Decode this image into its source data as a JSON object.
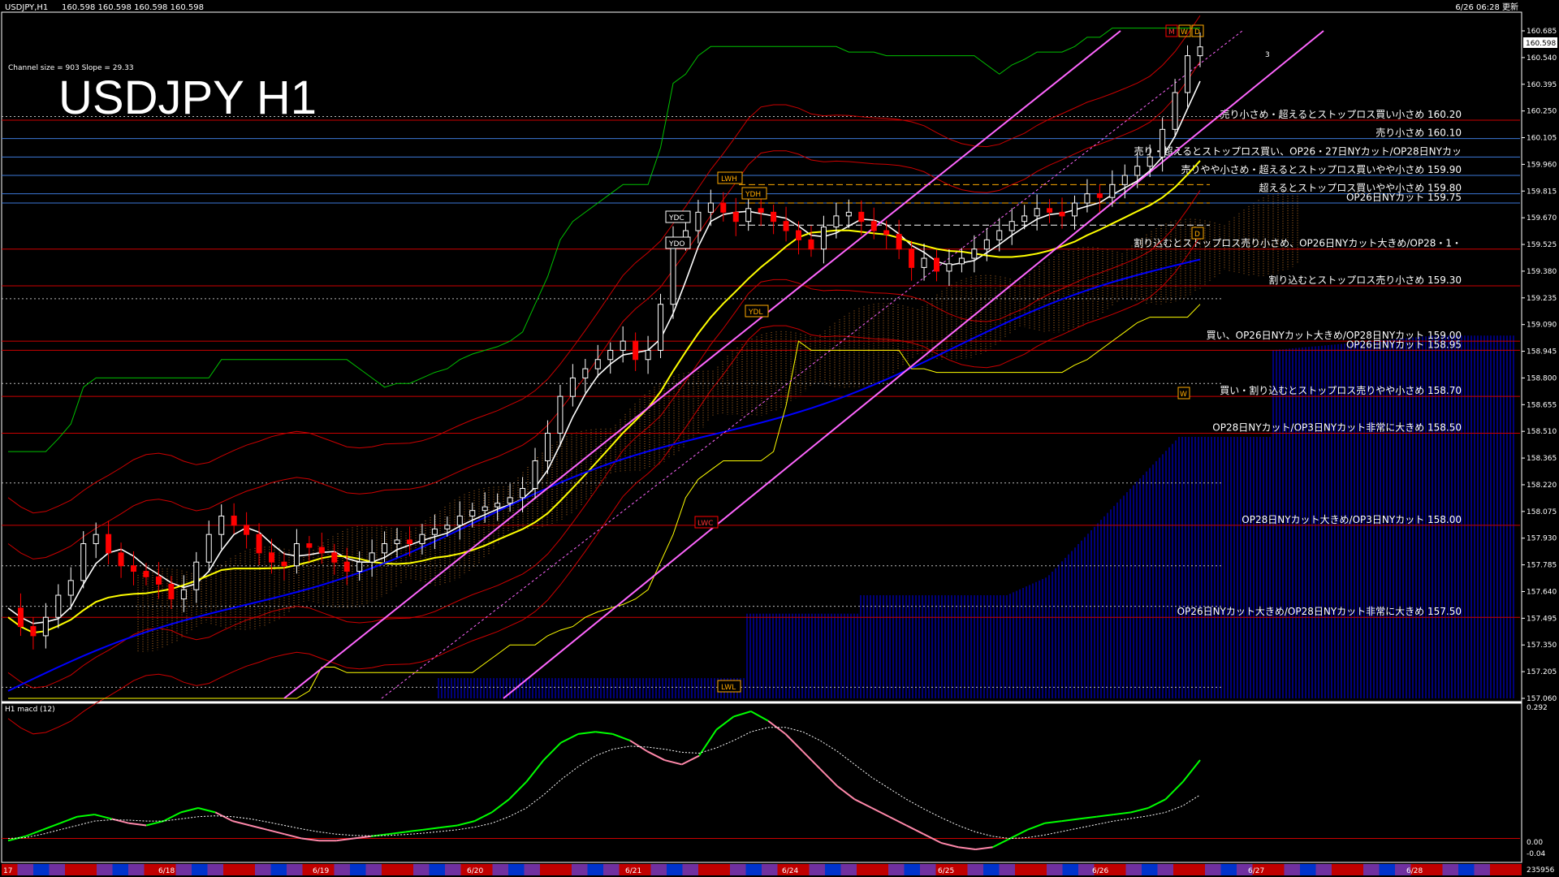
{
  "header": {
    "symbol_info": "USDJPY,H1",
    "ohlc": "160.598 160.598 160.598 160.598",
    "updated": "6/26 06:28 更新",
    "channel_info": "Channel size = 903 Slope = 29.33",
    "big_title": "USDJPY H1"
  },
  "sub_panel": {
    "label": "H1  macd (12)",
    "top_value": "0.292",
    "zero_value": "0.00",
    "bottom_value": "-0.04"
  },
  "bottom_right_value": "235956",
  "markers": {
    "month": "M",
    "week": "W",
    "day": "D",
    "lwh": "LWH",
    "ydh": "YDH",
    "ydc": "YDC",
    "ydo": "YDO",
    "ydl": "YDL",
    "lwl": "LWL",
    "lwx": "LWC",
    "wk2": "W",
    "d2": "D",
    "channel_num": "3"
  },
  "colors": {
    "background": "#000000",
    "bull_candle": "#ffffff",
    "bear_candle": "#ff0000",
    "sma_short": "#ffffff",
    "sma_mid": "#ffff00",
    "sma_long": "#0000ff",
    "channel": "#ff66ff",
    "donchian": "#00c000",
    "ichimoku_cloud": "#0000cc",
    "level_line_red": "#cc0000",
    "level_line_blue": "#3c78d8"
  },
  "chart_data": {
    "type": "line",
    "title": "USDJPY H1",
    "ylim": [
      157.06,
      160.685
    ],
    "y_ticks": [
      "160.685",
      "160.540",
      "160.395",
      "160.250",
      "160.105",
      "159.960",
      "159.815",
      "159.670",
      "159.525",
      "159.380",
      "159.235",
      "159.090",
      "158.945",
      "158.800",
      "158.655",
      "158.510",
      "158.365",
      "158.220",
      "158.075",
      "157.930",
      "157.785",
      "157.640",
      "157.495",
      "157.350",
      "157.205",
      "157.060"
    ],
    "current_price": "160.598",
    "x_labels": [
      "17",
      "6/18",
      "6/19",
      "6/20",
      "6/21",
      "6/24",
      "6/25",
      "6/26",
      "6/27",
      "6/28"
    ],
    "levels": [
      {
        "price": 160.2,
        "label": "売り小さめ・超えるとストップロス買い小さめ 160.20"
      },
      {
        "price": 160.1,
        "label": "売り小さめ 160.10"
      },
      {
        "price": 160.0,
        "label": "売り・超えるとストップロス買い、OP26・27日NYカット/OP28日NYカッ"
      },
      {
        "price": 159.9,
        "label": "売りやや小さめ・超えるとストップロス買いやや小さめ 159.90"
      },
      {
        "price": 159.8,
        "label": "超えるとストップロス買いやや小さめ 159.80"
      },
      {
        "price": 159.75,
        "label": "OP26日NYカット 159.75"
      },
      {
        "price": 159.5,
        "label": "割り込むとストップロス売り小さめ、OP26日NYカット大きめ/OP28・1・"
      },
      {
        "price": 159.3,
        "label": "割り込むとストップロス売り小さめ 159.30"
      },
      {
        "price": 159.0,
        "label": "買い、OP26日NYカット大きめ/OP28日NYカット 159.00"
      },
      {
        "price": 158.95,
        "label": "OP26日NYカット 158.95"
      },
      {
        "price": 158.7,
        "label": "買い・割り込むとストップロス売りやや小さめ 158.70"
      },
      {
        "price": 158.5,
        "label": "OP28日NYカット/OP3日NYカット非常に大きめ 158.50"
      },
      {
        "price": 158.0,
        "label": "OP28日NYカット大きめ/OP3日NYカット 158.00"
      },
      {
        "price": 157.5,
        "label": "OP26日NYカット大きめ/OP28日NYカット非常に大きめ 157.50"
      }
    ],
    "series": [
      {
        "name": "price",
        "values": [
          157.55,
          157.45,
          157.4,
          157.5,
          157.62,
          157.7,
          157.9,
          157.95,
          157.85,
          157.78,
          157.75,
          157.72,
          157.68,
          157.6,
          157.65,
          157.8,
          157.95,
          158.05,
          158.0,
          157.95,
          157.85,
          157.8,
          157.78,
          157.9,
          157.88,
          157.85,
          157.8,
          157.75,
          157.8,
          157.85,
          157.9,
          157.92,
          157.9,
          157.95,
          157.98,
          158.0,
          158.05,
          158.08,
          158.1,
          158.12,
          158.15,
          158.2,
          158.35,
          158.5,
          158.7,
          158.8,
          158.85,
          158.9,
          158.95,
          159.0,
          158.9,
          158.95,
          159.2,
          159.55,
          159.6,
          159.7,
          159.75,
          159.7,
          159.65,
          159.72,
          159.7,
          159.65,
          159.6,
          159.55,
          159.5,
          159.62,
          159.68,
          159.7,
          159.65,
          159.6,
          159.58,
          159.5,
          159.4,
          159.45,
          159.38,
          159.42,
          159.45,
          159.5,
          159.55,
          159.6,
          159.65,
          159.68,
          159.72,
          159.7,
          159.68,
          159.75,
          159.8,
          159.78,
          159.85,
          159.9,
          159.95,
          160.0,
          160.15,
          160.35,
          160.55,
          160.598
        ]
      },
      {
        "name": "macd",
        "values": [
          -0.005,
          0.005,
          0.02,
          0.035,
          0.05,
          0.055,
          0.045,
          0.035,
          0.03,
          0.04,
          0.06,
          0.07,
          0.06,
          0.04,
          0.03,
          0.02,
          0.01,
          0.0,
          -0.005,
          -0.005,
          0.0,
          0.005,
          0.01,
          0.015,
          0.02,
          0.025,
          0.03,
          0.04,
          0.06,
          0.09,
          0.13,
          0.18,
          0.22,
          0.24,
          0.245,
          0.24,
          0.225,
          0.2,
          0.18,
          0.17,
          0.19,
          0.25,
          0.28,
          0.292,
          0.27,
          0.24,
          0.2,
          0.16,
          0.12,
          0.09,
          0.07,
          0.05,
          0.03,
          0.01,
          -0.01,
          -0.02,
          -0.025,
          -0.02,
          0.0,
          0.02,
          0.035,
          0.04,
          0.045,
          0.05,
          0.055,
          0.06,
          0.07,
          0.09,
          0.13,
          0.18
        ]
      },
      {
        "name": "signal",
        "values": [
          0.0,
          0.002,
          0.01,
          0.02,
          0.03,
          0.04,
          0.043,
          0.042,
          0.04,
          0.04,
          0.045,
          0.05,
          0.052,
          0.05,
          0.045,
          0.038,
          0.03,
          0.022,
          0.015,
          0.01,
          0.007,
          0.006,
          0.007,
          0.009,
          0.012,
          0.016,
          0.02,
          0.026,
          0.035,
          0.05,
          0.07,
          0.1,
          0.135,
          0.165,
          0.19,
          0.205,
          0.212,
          0.21,
          0.205,
          0.198,
          0.196,
          0.208,
          0.225,
          0.245,
          0.255,
          0.255,
          0.245,
          0.225,
          0.2,
          0.17,
          0.14,
          0.115,
          0.09,
          0.068,
          0.048,
          0.03,
          0.015,
          0.005,
          0.0,
          0.002,
          0.008,
          0.016,
          0.024,
          0.032,
          0.04,
          0.046,
          0.052,
          0.06,
          0.075,
          0.1
        ]
      }
    ]
  }
}
